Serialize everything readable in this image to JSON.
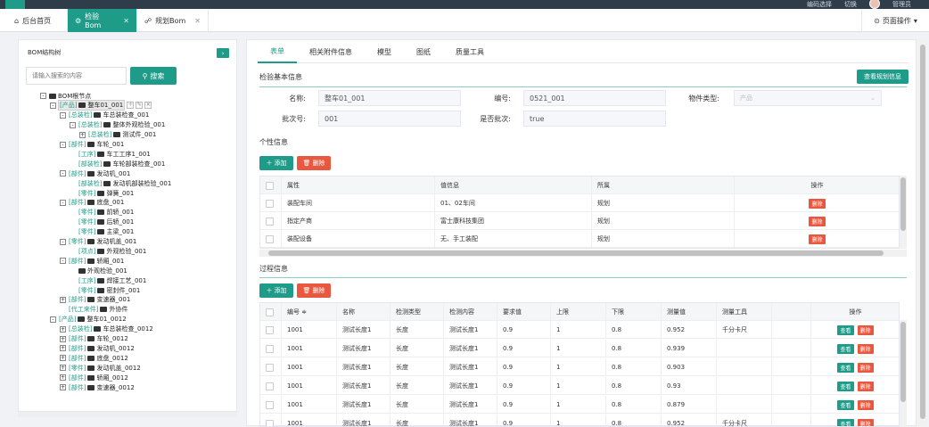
{
  "topbar": {
    "items": [
      "编码选择",
      "切换"
    ],
    "user": "管理员"
  },
  "tabs": [
    {
      "label": "后台首页",
      "icon": "home-icon"
    },
    {
      "label": "检验Bom",
      "icon": "gear-icon",
      "active": true
    },
    {
      "label": "规划Bom",
      "icon": "sitemap-icon"
    }
  ],
  "page_operation": "页面操作",
  "left": {
    "title": "BOM结构树",
    "search_placeholder": "请输入搜索的内容",
    "search_button": "搜索",
    "tree": [
      {
        "t": "",
        "n": "BOM根节点",
        "lv": 0,
        "box": "-"
      },
      {
        "t": "[产品]",
        "n": "整车01_001",
        "lv": 1,
        "box": "-",
        "sel": true
      },
      {
        "t": "[总装检]",
        "n": "车总装检查_001",
        "lv": 2,
        "box": "-"
      },
      {
        "t": "[总装检]",
        "n": "整体外观检验_001",
        "lv": 3,
        "box": "-"
      },
      {
        "t": "[总装检]",
        "n": "测试件_001",
        "lv": 4,
        "box": "+"
      },
      {
        "t": "[部件]",
        "n": "车轮_001",
        "lv": 2,
        "box": "-"
      },
      {
        "t": "[工序]",
        "n": "车工工序1_001",
        "lv": 3,
        "box": ""
      },
      {
        "t": "[部装检]",
        "n": "车轮部装检查_001",
        "lv": 3,
        "box": ""
      },
      {
        "t": "[部件]",
        "n": "发动机_001",
        "lv": 2,
        "box": "-"
      },
      {
        "t": "[部装检]",
        "n": "发动机部装检验_001",
        "lv": 3,
        "box": ""
      },
      {
        "t": "[零件]",
        "n": "弹簧_001",
        "lv": 3,
        "box": ""
      },
      {
        "t": "[部件]",
        "n": "底盘_001",
        "lv": 2,
        "box": "-"
      },
      {
        "t": "[零件]",
        "n": "前轿_001",
        "lv": 3,
        "box": ""
      },
      {
        "t": "[零件]",
        "n": "后轿_001",
        "lv": 3,
        "box": ""
      },
      {
        "t": "[零件]",
        "n": "主梁_001",
        "lv": 3,
        "box": ""
      },
      {
        "t": "[零件]",
        "n": "发动机盖_001",
        "lv": 2,
        "box": "-"
      },
      {
        "t": "[项点]",
        "n": "外观检验_001",
        "lv": 3,
        "box": ""
      },
      {
        "t": "[部件]",
        "n": "轿厢_001",
        "lv": 2,
        "box": "-"
      },
      {
        "t": "",
        "n": "外观检验_001",
        "lv": 3,
        "box": ""
      },
      {
        "t": "[工序]",
        "n": "焊接工艺_001",
        "lv": 3,
        "box": ""
      },
      {
        "t": "[零件]",
        "n": "密封件_001",
        "lv": 3,
        "box": ""
      },
      {
        "t": "[部件]",
        "n": "变速器_001",
        "lv": 2,
        "box": "+"
      },
      {
        "t": "[代工来件]",
        "n": "外协件",
        "lv": 2,
        "box": ""
      },
      {
        "t": "[产品]",
        "n": "整车01_0012",
        "lv": 1,
        "box": "-"
      },
      {
        "t": "[总装检]",
        "n": "车总装检查_0012",
        "lv": 2,
        "box": "+"
      },
      {
        "t": "[部件]",
        "n": "车轮_0012",
        "lv": 2,
        "box": "+"
      },
      {
        "t": "[部件]",
        "n": "发动机_0012",
        "lv": 2,
        "box": "+"
      },
      {
        "t": "[部件]",
        "n": "底盘_0012",
        "lv": 2,
        "box": "+"
      },
      {
        "t": "[零件]",
        "n": "发动机盖_0012",
        "lv": 2,
        "box": "+"
      },
      {
        "t": "[部件]",
        "n": "轿厢_0012",
        "lv": 2,
        "box": "+"
      },
      {
        "t": "[部件]",
        "n": "变速器_0012",
        "lv": 2,
        "box": "+"
      }
    ]
  },
  "right": {
    "tabs": [
      "表单",
      "相关附件信息",
      "模型",
      "图纸",
      "质量工具"
    ],
    "basic": {
      "title": "检验基本信息",
      "view_plan_button": "查看规划信息",
      "name_label": "名称:",
      "name_value": "整车01_001",
      "code_label": "编号:",
      "code_value": "0521_001",
      "type_label": "物件类型:",
      "type_placeholder": "产品",
      "batch_label": "批次号:",
      "batch_value": "001",
      "isbatch_label": "是否批次:",
      "isbatch_value": "true"
    },
    "personal": {
      "title": "个性信息",
      "add": "添加",
      "delete": "删除",
      "headers": [
        "属性",
        "值信息",
        "所属",
        "操作"
      ],
      "rows": [
        [
          "装配车间",
          "01、02车间",
          "规划",
          "删除"
        ],
        [
          "指定产商",
          "富士康科技集团",
          "规划",
          "删除"
        ],
        [
          "装配设备",
          "无、手工装配",
          "规划",
          "删除"
        ]
      ]
    },
    "process": {
      "title": "过程信息",
      "add": "添加",
      "delete": "删除",
      "headers": [
        "编号 ≑",
        "名称",
        "检测类型",
        "检测内容",
        "要求值",
        "上限",
        "下限",
        "测量值",
        "测量工具",
        "测量人员",
        "操作"
      ],
      "view": "查看",
      "del": "删除",
      "rows": [
        [
          "1001",
          "测试长度1",
          "长度",
          "测试长度1",
          "0.9",
          "1",
          "0.8",
          "0.952",
          "千分卡尺",
          ""
        ],
        [
          "1001",
          "测试长度1",
          "长度",
          "测试长度1",
          "0.9",
          "1",
          "0.8",
          "0.939",
          "",
          ""
        ],
        [
          "1001",
          "测试长度1",
          "长度",
          "测试长度1",
          "0.9",
          "1",
          "0.8",
          "0.903",
          "",
          ""
        ],
        [
          "1001",
          "测试长度1",
          "长度",
          "测试长度1",
          "0.9",
          "1",
          "0.8",
          "0.93",
          "",
          ""
        ],
        [
          "1001",
          "测试长度1",
          "长度",
          "测试长度1",
          "0.9",
          "1",
          "0.8",
          "0.879",
          "",
          ""
        ]
      ]
    }
  }
}
